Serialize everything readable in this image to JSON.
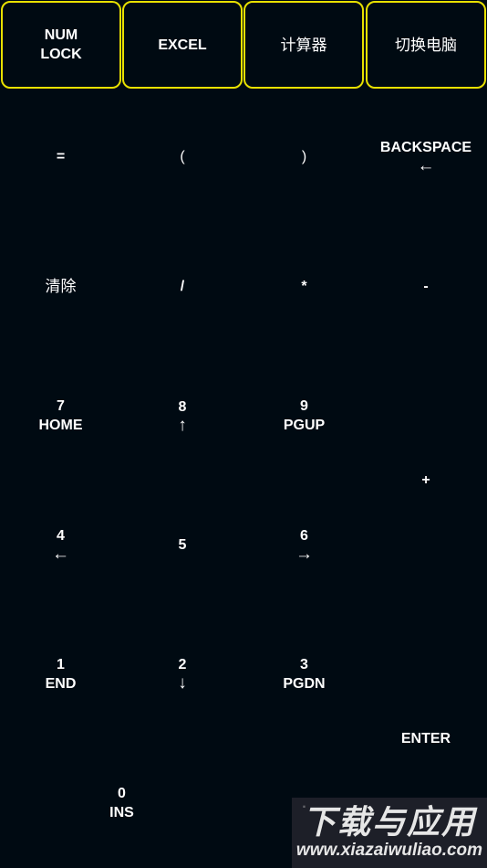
{
  "top_buttons": {
    "num_lock": "NUM\nLOCK",
    "excel": "EXCEL",
    "calculator": "计算器",
    "switch_pc": "切换电脑"
  },
  "keys": {
    "equals": {
      "main": "="
    },
    "lparen": {
      "main": "("
    },
    "rparen": {
      "main": ")"
    },
    "backspace": {
      "main": "BACKSPACE",
      "sub": "←"
    },
    "clear": {
      "main": "清除"
    },
    "divide": {
      "main": "/"
    },
    "multiply": {
      "main": "*"
    },
    "minus": {
      "main": "-"
    },
    "k7": {
      "main": "7",
      "sub": "HOME"
    },
    "k8": {
      "main": "8",
      "sub": "↑"
    },
    "k9": {
      "main": "9",
      "sub": "PGUP"
    },
    "plus": {
      "main": "+"
    },
    "k4": {
      "main": "4",
      "sub": "←"
    },
    "k5": {
      "main": "5"
    },
    "k6": {
      "main": "6",
      "sub": "→"
    },
    "k1": {
      "main": "1",
      "sub": "END"
    },
    "k2": {
      "main": "2",
      "sub": "↓"
    },
    "k3": {
      "main": "3",
      "sub": "PGDN"
    },
    "enter": {
      "main": "ENTER"
    },
    "k0": {
      "main": "0",
      "sub": "INS"
    },
    "decimal": {
      "main": "."
    }
  },
  "watermark": {
    "title": "下载与应用",
    "url": "www.xiazaiwuliao.com"
  }
}
